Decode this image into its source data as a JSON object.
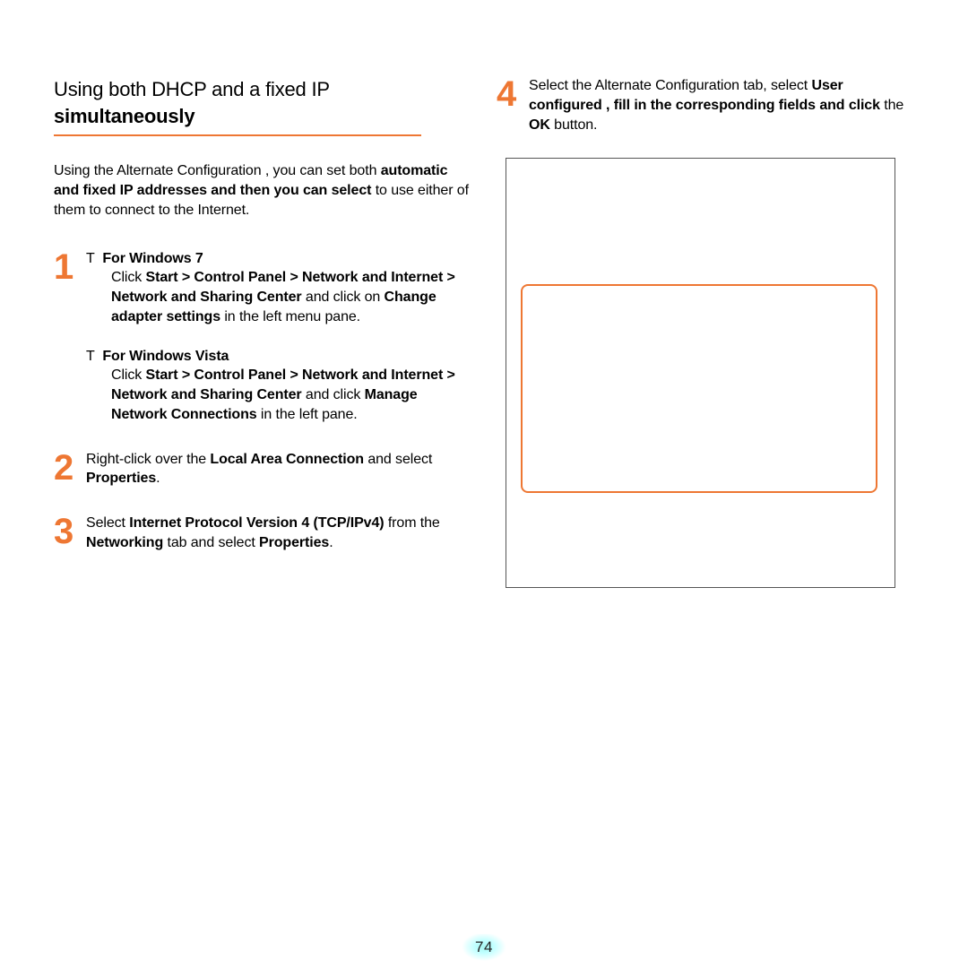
{
  "title": {
    "line1": "Using both DHCP and a fixed IP",
    "line2": "simultaneously"
  },
  "intro": {
    "pre": "Using the Alternate Configuration    , you can set both ",
    "bold": "automatic and fixed IP addresses and then you can select",
    "post": " to use either of them to connect to the Internet."
  },
  "steps": {
    "s1": {
      "num": "1",
      "win7": {
        "marker": "T",
        "head": "For Windows 7",
        "t1": "Click ",
        "b1": "Start > Control Panel > Network and Internet > Network and Sharing Center",
        "t2": " and click on ",
        "b2": "Change adapter settings",
        "t3": " in the left menu pane."
      },
      "vista": {
        "marker": "T",
        "head": "For Windows Vista",
        "t1": "Click ",
        "b1": "Start > Control Panel > Network and Internet > Network and Sharing Center",
        "t2": " and click ",
        "b2": "Manage Network Connections",
        "t3": " in the left pane."
      }
    },
    "s2": {
      "num": "2",
      "t1": "Right-click over the ",
      "b1": "Local Area Connection",
      "t2": " and select ",
      "b2": "Properties",
      "t3": "."
    },
    "s3": {
      "num": "3",
      "t1": "Select ",
      "b1": "Internet Protocol Version 4 (TCP/IPv4)",
      "t2": " from the ",
      "b2": "Networking",
      "t3": " tab and select ",
      "b3": "Properties",
      "t4": "."
    },
    "s4": {
      "num": "4",
      "t1": "Select the Alternate Configuration    tab, select ",
      "b1": "User configured",
      "t2": "  ",
      "b2": ", fill in the corresponding fields and click",
      "t3": " the ",
      "b3": "OK",
      "t4": " button."
    }
  },
  "page_number": "74"
}
